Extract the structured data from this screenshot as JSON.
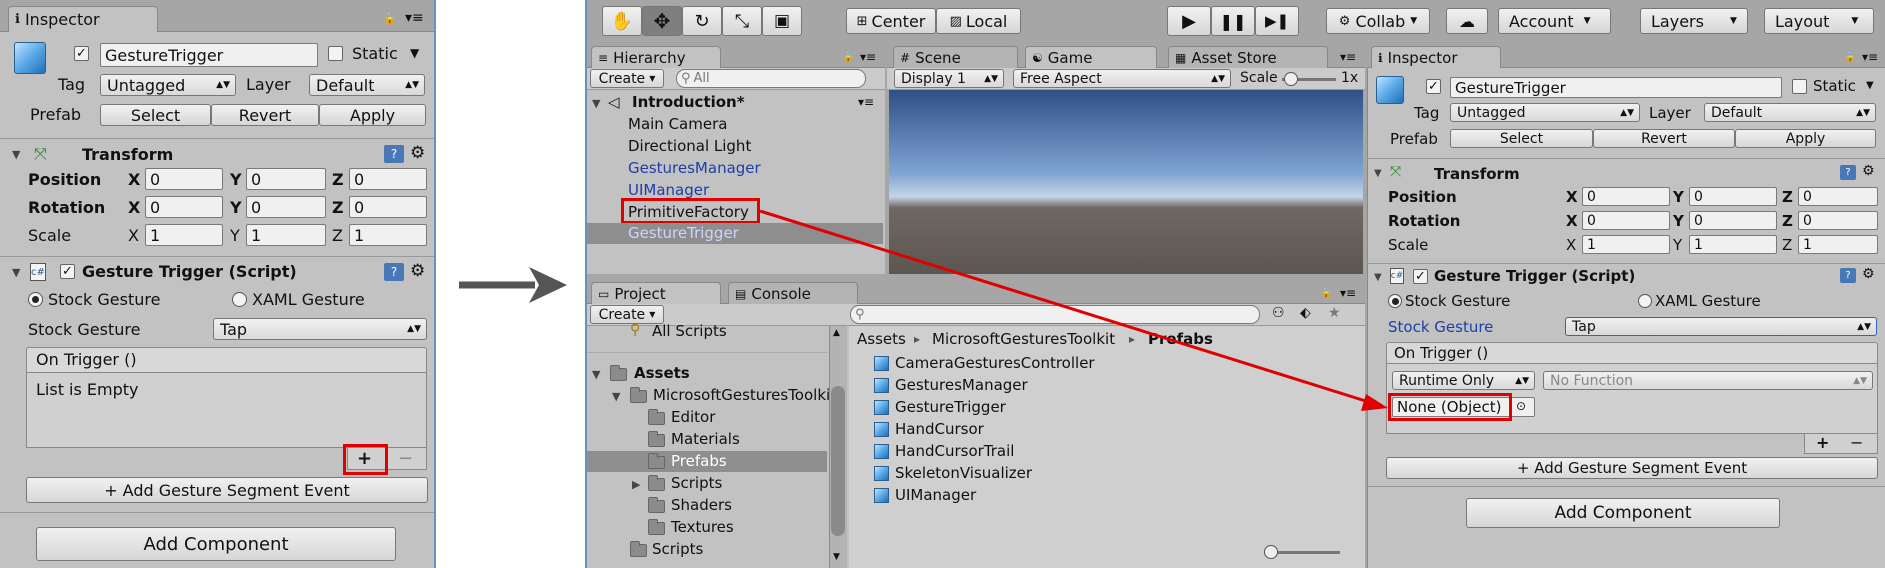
{
  "colors": {
    "panel": "#c2c2c2",
    "toolbar": "#a6a6a6",
    "highlight_red": "#e00000",
    "selected_row": "#8e8e8e",
    "link_blue": "#1c3fa8"
  },
  "left_inspector": {
    "tab_label": "Inspector",
    "object_name": "GestureTrigger",
    "static_label": "Static",
    "tag_label": "Tag",
    "tag_value": "Untagged",
    "layer_label": "Layer",
    "layer_value": "Default",
    "prefab_label": "Prefab",
    "select_label": "Select",
    "revert_label": "Revert",
    "apply_label": "Apply",
    "transform_label": "Transform",
    "position_label": "Position",
    "rotation_label": "Rotation",
    "scale_label": "Scale",
    "x": "X",
    "y": "Y",
    "z": "Z",
    "pos": [
      "0",
      "0",
      "0"
    ],
    "rot": [
      "0",
      "0",
      "0"
    ],
    "scl": [
      "1",
      "1",
      "1"
    ],
    "script_title": "Gesture Trigger (Script)",
    "stock_gesture_radio": "Stock Gesture",
    "xaml_gesture_radio": "XAML Gesture",
    "stock_gesture_label": "Stock Gesture",
    "stock_gesture_value": "Tap",
    "on_trigger": "On Trigger ()",
    "list_empty": "List is Empty",
    "plus": "+",
    "minus": "−",
    "add_segment": "+ Add Gesture Segment Event",
    "add_component": "Add Component"
  },
  "toolbar": {
    "center_label": "Center",
    "local_label": "Local",
    "collab_label": "Collab",
    "account_label": "Account",
    "layers_label": "Layers",
    "layout_label": "Layout"
  },
  "hierarchy": {
    "tab_label": "Hierarchy",
    "create_label": "Create",
    "search_placeholder": "All",
    "scene_name": "Introduction*",
    "items": [
      "Main Camera",
      "Directional Light",
      "GesturesManager",
      "UIManager",
      "PrimitiveFactory",
      "GestureTrigger"
    ]
  },
  "scene_tabs": {
    "scene": "Scene",
    "game": "Game",
    "asset_store": "Asset Store"
  },
  "game_bar": {
    "display": "Display 1",
    "aspect": "Free Aspect",
    "scale_label": "Scale",
    "scale_value": "1x"
  },
  "project": {
    "tab_label": "Project",
    "console_label": "Console",
    "create_label": "Create",
    "top_item": "All Scripts",
    "tree": [
      "Assets",
      "MicrosoftGesturesToolkit",
      "Editor",
      "Materials",
      "Prefabs",
      "Scripts",
      "Shaders",
      "Textures",
      "Scripts"
    ],
    "breadcrumb": [
      "Assets",
      "MicrosoftGesturesToolkit",
      "Prefabs"
    ],
    "breadcrumb_sep": "▸",
    "assets": [
      "CameraGesturesController",
      "GesturesManager",
      "GestureTrigger",
      "HandCursor",
      "HandCursorTrail",
      "SkeletonVisualizer",
      "UIManager"
    ]
  },
  "right_inspector": {
    "tab_label": "Inspector",
    "object_name": "GestureTrigger",
    "static_label": "Static",
    "tag_label": "Tag",
    "tag_value": "Untagged",
    "layer_label": "Layer",
    "layer_value": "Default",
    "prefab_label": "Prefab",
    "select_label": "Select",
    "revert_label": "Revert",
    "apply_label": "Apply",
    "transform_label": "Transform",
    "position_label": "Position",
    "rotation_label": "Rotation",
    "scale_label": "Scale",
    "x": "X",
    "y": "Y",
    "z": "Z",
    "pos": [
      "0",
      "0",
      "0"
    ],
    "rot": [
      "0",
      "0",
      "0"
    ],
    "scl": [
      "1",
      "1",
      "1"
    ],
    "script_title": "Gesture Trigger (Script)",
    "stock_gesture_radio": "Stock Gesture",
    "xaml_gesture_radio": "XAML Gesture",
    "stock_gesture_label": "Stock Gesture",
    "stock_gesture_value": "Tap",
    "on_trigger": "On Trigger ()",
    "runtime_value": "Runtime Only",
    "function_value": "No Function",
    "object_value": "None (Object)",
    "plus": "+",
    "minus": "−",
    "add_segment": "+ Add Gesture Segment Event",
    "add_component": "Add Component"
  }
}
